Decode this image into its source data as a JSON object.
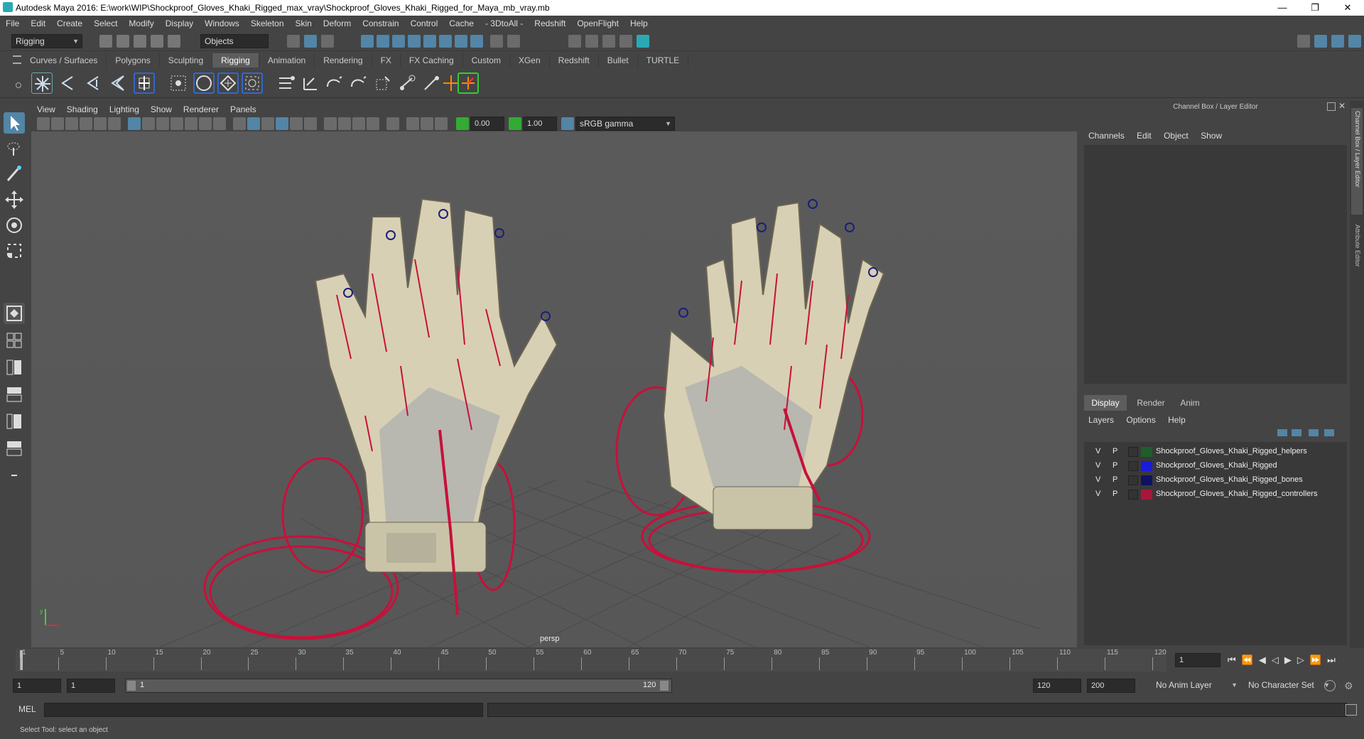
{
  "titlebar": {
    "title": "Autodesk Maya 2016: E:\\work\\WIP\\Shockproof_Gloves_Khaki_Rigged_max_vray\\Shockproof_Gloves_Khaki_Rigged_for_Maya_mb_vray.mb",
    "minimize": "—",
    "maximize": "❐",
    "close": "✕"
  },
  "menubar": [
    "File",
    "Edit",
    "Create",
    "Select",
    "Modify",
    "Display",
    "Windows",
    "Skeleton",
    "Skin",
    "Deform",
    "Constrain",
    "Control",
    "Cache",
    "- 3DtoAll -",
    "Redshift",
    "OpenFlight",
    "Help"
  ],
  "statusline": {
    "mode": "Rigging",
    "selection_mode": "Objects"
  },
  "shelf_tabs": [
    "Curves / Surfaces",
    "Polygons",
    "Sculpting",
    "Rigging",
    "Animation",
    "Rendering",
    "FX",
    "FX Caching",
    "Custom",
    "XGen",
    "Redshift",
    "Bullet",
    "TURTLE"
  ],
  "active_shelf_tab": "Rigging",
  "panel_menu": [
    "View",
    "Shading",
    "Lighting",
    "Show",
    "Renderer",
    "Panels"
  ],
  "panel_toolbar": {
    "exposure": "0.00",
    "gamma": "1.00",
    "color_space": "sRGB gamma"
  },
  "viewport": {
    "camera_label": "persp",
    "axis_y": "y",
    "axis_x": "x"
  },
  "channel_box": {
    "title": "Channel Box / Layer Editor",
    "menus": [
      "Channels",
      "Edit",
      "Object",
      "Show"
    ]
  },
  "layer_editor": {
    "tabs": [
      "Display",
      "Render",
      "Anim"
    ],
    "active_tab": "Display",
    "menus": [
      "Layers",
      "Options",
      "Help"
    ],
    "layers": [
      {
        "v": "V",
        "p": "P",
        "color": "#1f5d2c",
        "name": "Shockproof_Gloves_Khaki_Rigged_helpers"
      },
      {
        "v": "V",
        "p": "P",
        "color": "#1b1bdc",
        "name": "Shockproof_Gloves_Khaki_Rigged"
      },
      {
        "v": "V",
        "p": "P",
        "color": "#0f1163",
        "name": "Shockproof_Gloves_Khaki_Rigged_bones"
      },
      {
        "v": "V",
        "p": "P",
        "color": "#a8163a",
        "name": "Shockproof_Gloves_Khaki_Rigged_controllers"
      }
    ]
  },
  "side_tabs": [
    "Channel Box / Layer Editor",
    "Attribute Editor"
  ],
  "timeslider": {
    "ticks": [
      "1",
      "5",
      "10",
      "15",
      "20",
      "25",
      "30",
      "35",
      "40",
      "45",
      "50",
      "55",
      "60",
      "65",
      "70",
      "75",
      "80",
      "85",
      "90",
      "95",
      "100",
      "105",
      "110",
      "115",
      "120"
    ],
    "current_frame": "1"
  },
  "range": {
    "start": "1",
    "playback_start": "1",
    "slider_start": "1",
    "slider_end": "120",
    "playback_end": "120",
    "end": "200",
    "anim_layer": "No Anim Layer",
    "character_set": "No Character Set"
  },
  "cmdline": {
    "label": "MEL"
  },
  "helpline": {
    "text": "Select Tool: select an object"
  },
  "colors": {
    "wire": "#c8103a",
    "glove": "#d8d0b4",
    "accent": "#5285a6"
  }
}
